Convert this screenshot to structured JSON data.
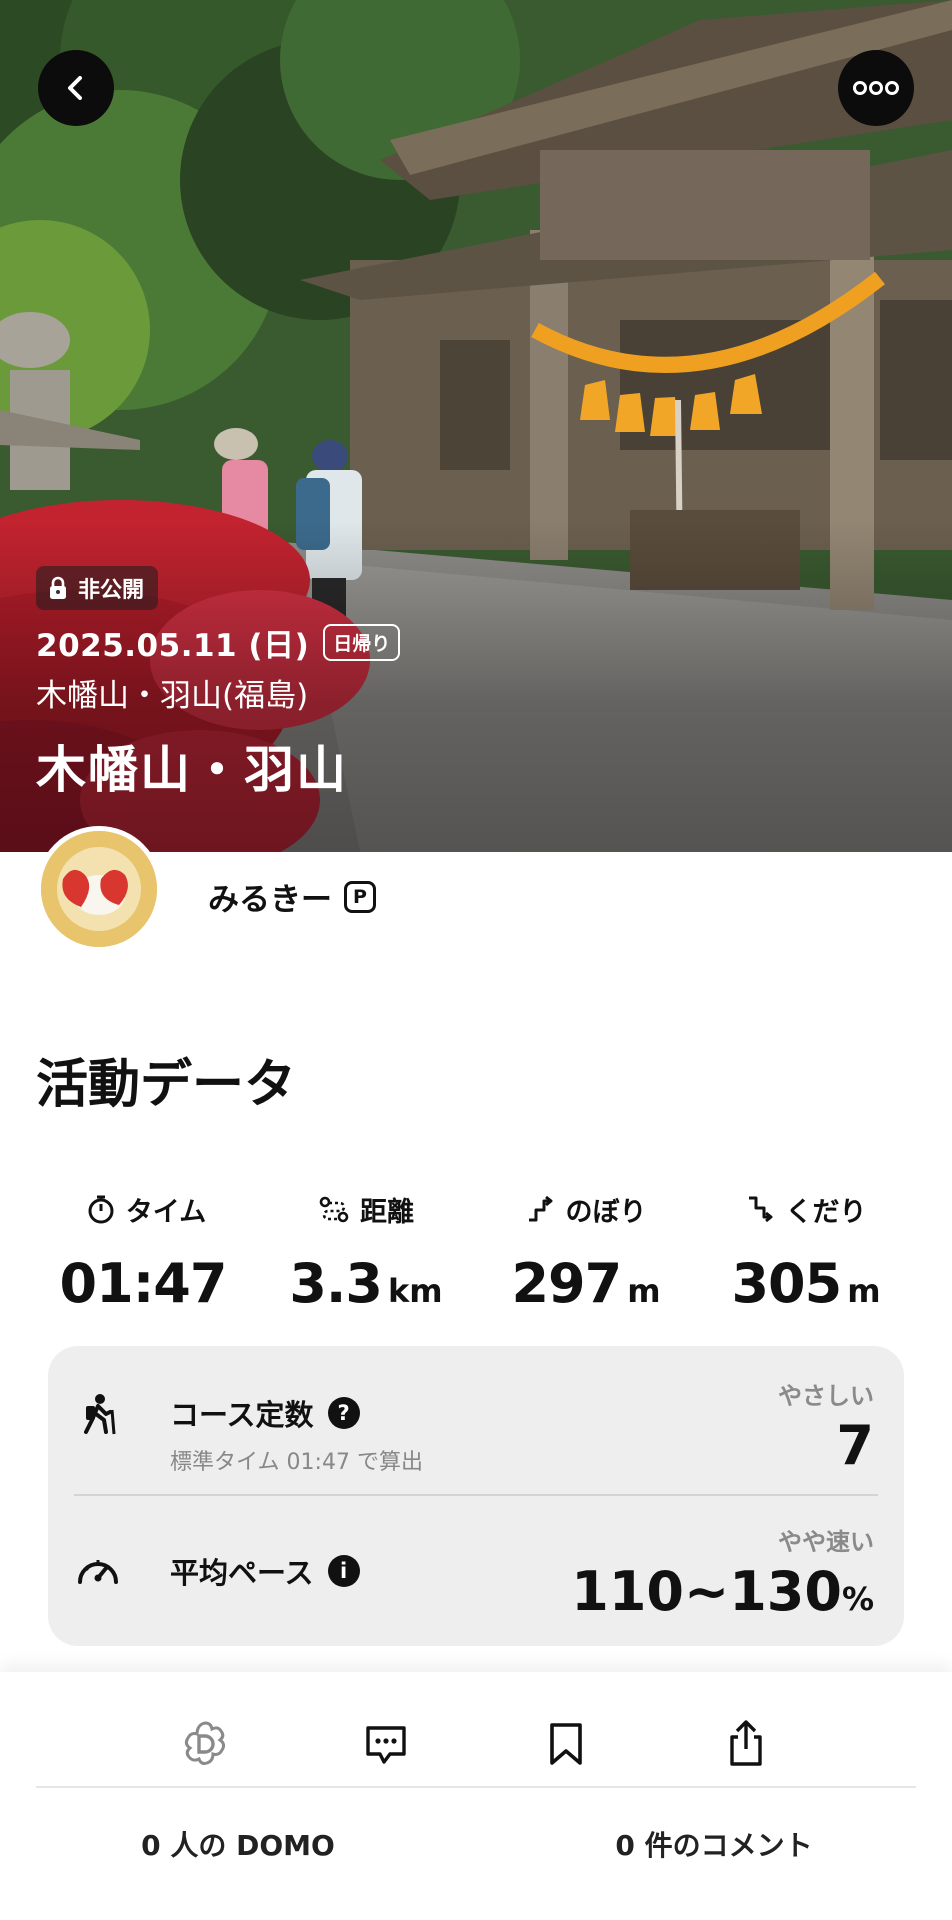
{
  "hero": {
    "privacy_label": "非公開",
    "date": "2025.05.11 (日)",
    "trip_type": "日帰り",
    "area": "木幡山・羽山(福島)",
    "title": "木幡山・羽山"
  },
  "user": {
    "name": "みるきー",
    "premium_mark": "P"
  },
  "activity": {
    "section_title": "活動データ",
    "stats": [
      {
        "icon": "stopwatch-icon",
        "label": "タイム",
        "value": "01:47",
        "unit": ""
      },
      {
        "icon": "route-icon",
        "label": "距離",
        "value": "3.3",
        "unit": "km"
      },
      {
        "icon": "ascent-icon",
        "label": "のぼり",
        "value": "297",
        "unit": "m"
      },
      {
        "icon": "descent-icon",
        "label": "くだり",
        "value": "305",
        "unit": "m"
      }
    ],
    "course_constant": {
      "icon": "hiker-icon",
      "title": "コース定数",
      "help_mark": "?",
      "subtitle": "標準タイム 01:47 で算出",
      "difficulty": "やさしい",
      "value": "7"
    },
    "average_pace": {
      "icon": "speedometer-icon",
      "title": "平均ペース",
      "info_mark": "i",
      "pace_label": "やや速い",
      "value": "110~130",
      "unit": "%"
    }
  },
  "bottom": {
    "actions": [
      "domo-icon",
      "comment-icon",
      "bookmark-icon",
      "share-icon"
    ],
    "domo_count": "0 人の DOMO",
    "comment_count": "0 件のコメント"
  },
  "colors": {
    "rope": "#f0a020",
    "card_bg": "#eeeeee",
    "text": "#111111"
  }
}
